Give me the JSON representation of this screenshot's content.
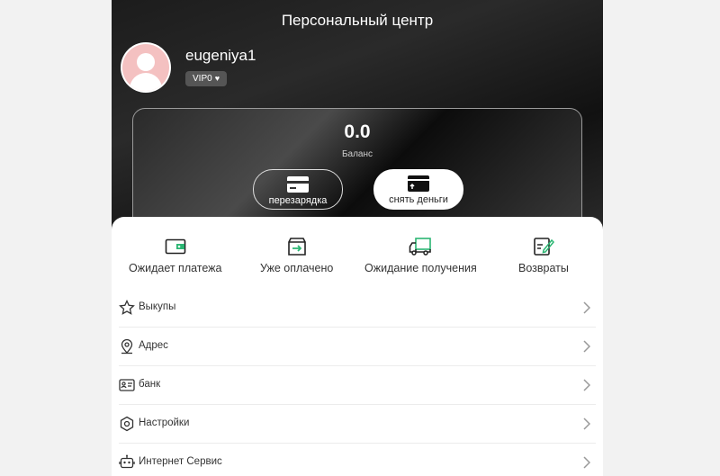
{
  "header": {
    "title": "Персональный центр"
  },
  "profile": {
    "username": "eugeniya1",
    "vip": "VIP0"
  },
  "balance": {
    "value": "0.0",
    "label": "Баланс"
  },
  "actions": {
    "recharge": "перезарядка",
    "withdraw": "снять деньги"
  },
  "orders": [
    {
      "label": "Ожидает платежа",
      "icon": "wallet-icon"
    },
    {
      "label": "Уже оплачено",
      "icon": "paid-box-icon"
    },
    {
      "label": "Ожидание получения",
      "icon": "delivery-truck-icon"
    },
    {
      "label": "Возвраты",
      "icon": "refund-edit-icon"
    }
  ],
  "menu": [
    {
      "label": "Выкупы",
      "icon": "star-icon"
    },
    {
      "label": "Адрес",
      "icon": "location-pin-icon"
    },
    {
      "label": "банк",
      "icon": "bank-card-icon"
    },
    {
      "label": "Настройки",
      "icon": "settings-gear-icon"
    },
    {
      "label": "Интернет Сервис",
      "icon": "support-bot-icon"
    }
  ],
  "colors": {
    "accent": "#2bb673",
    "dark": "#222222",
    "hero": "#1c1c1c"
  }
}
